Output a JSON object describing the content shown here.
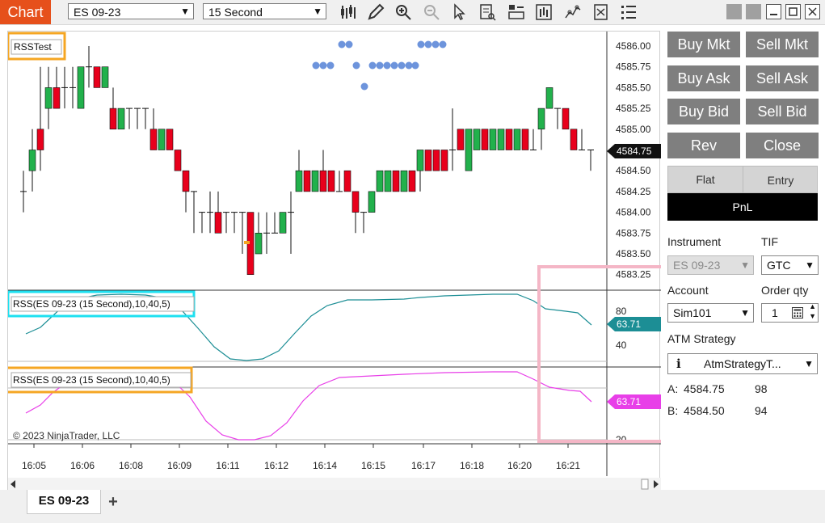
{
  "window": {
    "title": "Chart",
    "instrument_select": "ES 09-23",
    "interval_select": "15 Second",
    "toolbar_icons": [
      "bar-type-icon",
      "draw-pencil-icon",
      "zoom-in-icon",
      "zoom-out-icon",
      "pointer-icon",
      "data-box-icon",
      "chart-trader-icon",
      "strategies-icon",
      "indicators-icon",
      "templates-icon",
      "properties-icon"
    ],
    "window_buttons": [
      "gray-square-icon",
      "gray-square-icon",
      "minimize-icon",
      "maximize-icon",
      "close-icon"
    ]
  },
  "chart": {
    "indicator_label_top": "RSSTest",
    "indicator_label_mid": "RSS(ES 09-23 (15 Second),10,40,5)",
    "indicator_label_low": "RSS(ES 09-23 (15 Second),10,40,5)",
    "copyright": "© 2023 NinjaTrader, LLC",
    "price_labels": [
      "4586.00",
      "4585.75",
      "4585.50",
      "4585.25",
      "4585.00",
      "4584.50",
      "4584.25",
      "4584.00",
      "4583.75",
      "4583.50",
      "4583.25"
    ],
    "current_price": "4584.75",
    "mid_panel_ticks": [
      "80",
      "40"
    ],
    "mid_value": "63.71",
    "low_value": "63.71",
    "low_panel_tick": "20",
    "time_labels": [
      "16:05",
      "16:06",
      "16:08",
      "16:09",
      "16:11",
      "16:12",
      "16:14",
      "16:15",
      "16:17",
      "16:18",
      "16:20",
      "16:21"
    ],
    "colors": {
      "up": "#22b14c",
      "down": "#e8001c",
      "teal": "#1c8e95",
      "magenta": "#e83fe8",
      "highlight_orange": "#f5a623",
      "highlight_cyan": "#1ee0f0",
      "highlight_pink": "#f4b6c6",
      "dot": "#6d94dc"
    }
  },
  "trader": {
    "buttons": [
      {
        "label": "Buy Mkt"
      },
      {
        "label": "Sell Mkt"
      },
      {
        "label": "Buy Ask"
      },
      {
        "label": "Sell Ask"
      },
      {
        "label": "Buy Bid"
      },
      {
        "label": "Sell Bid"
      },
      {
        "label": "Rev"
      },
      {
        "label": "Close"
      }
    ],
    "position_flat": "Flat",
    "position_entry": "Entry",
    "pnl": "PnL",
    "instrument_label": "Instrument",
    "tif_label": "TIF",
    "instrument_value": "ES 09-23",
    "tif_value": "GTC",
    "account_label": "Account",
    "order_qty_label": "Order qty",
    "account_value": "Sim101",
    "order_qty_value": "1",
    "atm_label": "ATM Strategy",
    "atm_value": "AtmStrategyT...",
    "ask_label": "A:",
    "ask_price": "4584.75",
    "ask_size": "98",
    "bid_label": "B:",
    "bid_price": "4584.50",
    "bid_size": "94"
  },
  "tabs": {
    "active": "ES 09-23",
    "add": "+"
  }
}
